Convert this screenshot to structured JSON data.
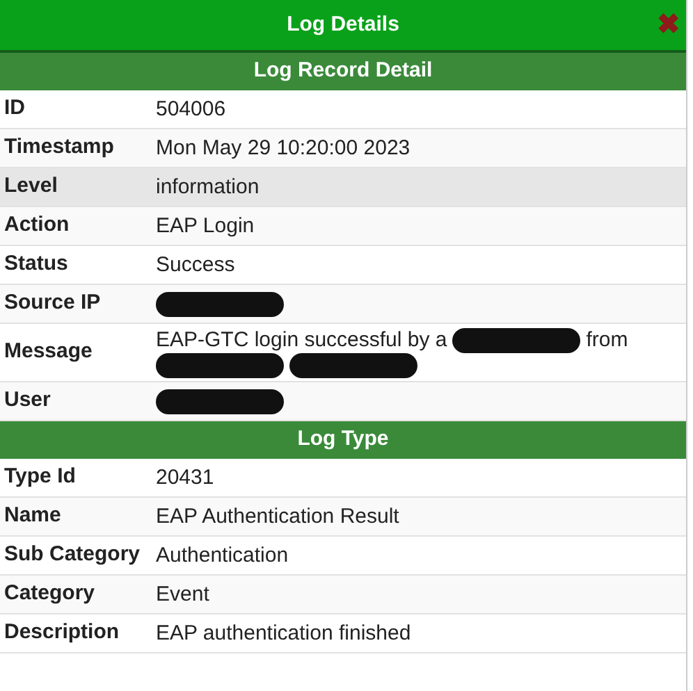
{
  "window": {
    "title": "Log Details",
    "close": "✖"
  },
  "sections": [
    {
      "title": "Log Record Detail",
      "rows": [
        {
          "label": "ID",
          "highlighted": false,
          "segments": [
            {
              "kind": "text",
              "text": "504006"
            }
          ]
        },
        {
          "label": "Timestamp",
          "highlighted": false,
          "segments": [
            {
              "kind": "text",
              "text": "Mon May 29 10:20:00 2023"
            }
          ]
        },
        {
          "label": "Level",
          "highlighted": true,
          "segments": [
            {
              "kind": "text",
              "text": "information"
            }
          ]
        },
        {
          "label": "Action",
          "highlighted": false,
          "segments": [
            {
              "kind": "text",
              "text": "EAP Login"
            }
          ]
        },
        {
          "label": "Status",
          "highlighted": false,
          "segments": [
            {
              "kind": "text",
              "text": "Success"
            }
          ]
        },
        {
          "label": "Source IP",
          "highlighted": false,
          "segments": [
            {
              "kind": "redacted"
            }
          ]
        },
        {
          "label": "Message",
          "highlighted": false,
          "segments": [
            {
              "kind": "text",
              "text": "EAP-GTC login successful by a"
            },
            {
              "kind": "redacted"
            },
            {
              "kind": "text",
              "text": "from"
            },
            {
              "kind": "redacted"
            },
            {
              "kind": "redacted"
            }
          ]
        },
        {
          "label": "User",
          "highlighted": false,
          "segments": [
            {
              "kind": "redacted"
            }
          ]
        }
      ]
    },
    {
      "title": "Log Type",
      "rows": [
        {
          "label": "Type Id",
          "highlighted": false,
          "segments": [
            {
              "kind": "text",
              "text": "20431"
            }
          ]
        },
        {
          "label": "Name",
          "highlighted": false,
          "segments": [
            {
              "kind": "text",
              "text": "EAP Authentication Result"
            }
          ]
        },
        {
          "label": "Sub Category",
          "highlighted": false,
          "segments": [
            {
              "kind": "text",
              "text": "Authentication"
            }
          ]
        },
        {
          "label": "Category",
          "highlighted": false,
          "segments": [
            {
              "kind": "text",
              "text": "Event"
            }
          ]
        },
        {
          "label": "Description",
          "highlighted": false,
          "segments": [
            {
              "kind": "text",
              "text": "EAP authentication finished"
            }
          ]
        }
      ]
    }
  ]
}
